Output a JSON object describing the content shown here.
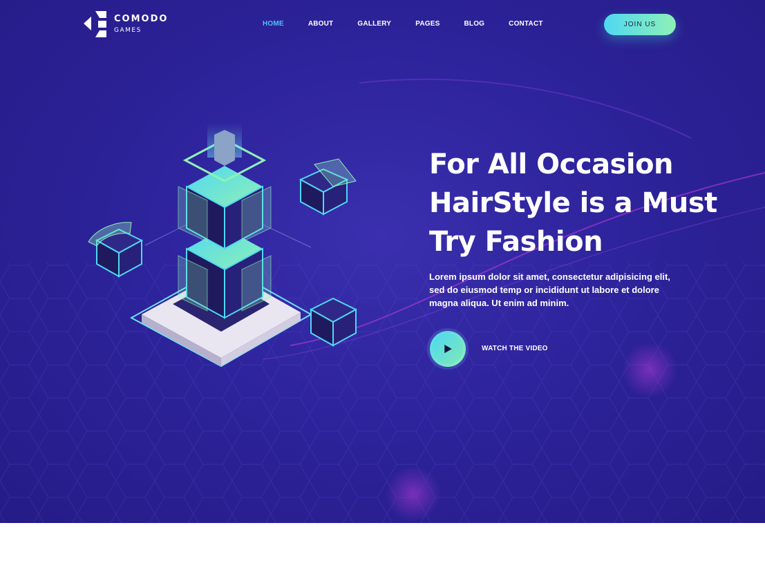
{
  "brand": {
    "name": "COMODO",
    "subtitle": "GAMES"
  },
  "nav": {
    "items": [
      {
        "label": "HOME",
        "active": true
      },
      {
        "label": "ABOUT",
        "active": false
      },
      {
        "label": "GALLERY",
        "active": false
      },
      {
        "label": "PAGES",
        "active": false
      },
      {
        "label": "BLOG",
        "active": false
      },
      {
        "label": "CONTACT",
        "active": false
      }
    ]
  },
  "join_button": {
    "label": "JOIN US"
  },
  "hero": {
    "headline_lines": [
      "For All Occasion",
      "HairStyle is a Must",
      "Try Fashion"
    ],
    "description": "Lorem ipsum dolor sit amet, consectetur adipisicing elit, sed do eiusmod temp or incididunt ut labore et dolore magna aliqua. Ut enim ad minim.",
    "watch_label": "WATCH THE VIDEO"
  },
  "icons": {
    "play": "play-icon",
    "logo": "logo-icon"
  },
  "colors": {
    "hero_bg": "#2d239b",
    "accent_cyan": "#4fd8f2",
    "accent_green": "#8ff0b6",
    "nav_active": "#4fc3f7",
    "text": "#ffffff"
  }
}
